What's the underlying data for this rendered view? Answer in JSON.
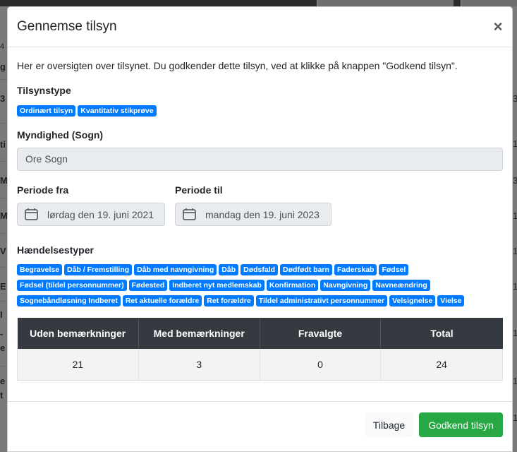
{
  "modal": {
    "title": "Gennemse tilsyn",
    "intro": "Her er oversigten over tilsynet. Du godkender dette tilsyn, ved at klikke på knappen \"Godkend tilsyn\".",
    "tilsynstype": {
      "label": "Tilsynstype",
      "badges": [
        "Ordinært tilsyn",
        "Kvantitativ stikprøve"
      ]
    },
    "myndighed": {
      "label": "Myndighed (Sogn)",
      "value": "Ore Sogn"
    },
    "periode_fra": {
      "label": "Periode fra",
      "value": "lørdag den 19. juni 2021"
    },
    "periode_til": {
      "label": "Periode til",
      "value": "mandag den 19. juni 2023"
    },
    "haendelsestyper": {
      "label": "Hændelsestyper",
      "badges": [
        "Begravelse",
        "Dåb / Fremstilling",
        "Dåb med navngivning",
        "Dåb",
        "Dødsfald",
        "Dødfødt barn",
        "Faderskab",
        "Fødsel",
        "Fødsel (tildel personnummer)",
        "Fødested",
        "Indberet nyt medlemskab",
        "Konfirmation",
        "Navngivning",
        "Navneændring",
        "Sognebåndløsning Indberet",
        "Ret aktuelle forældre",
        "Ret forældre",
        "Tildel administrativt personnummer",
        "Velsignelse",
        "Vielse"
      ]
    },
    "stats_table": {
      "headers": [
        "Uden bemærkninger",
        "Med bemærkninger",
        "Fravalgte",
        "Total"
      ],
      "values": [
        "21",
        "3",
        "0",
        "24"
      ]
    },
    "buttons": {
      "back": "Tilbage",
      "approve": "Godkend tilsyn"
    }
  },
  "background": {
    "left_fragments": [
      "4",
      "g",
      "3",
      "ti",
      "M",
      "M",
      "V",
      "E",
      "I",
      "-",
      "e",
      "e",
      "t"
    ],
    "right_fragments": [
      "3",
      "1",
      "3",
      "1",
      "1",
      "1",
      "1",
      "1",
      "1"
    ]
  },
  "icons": {
    "close": "close-icon",
    "calendar": "calendar-icon"
  },
  "colors": {
    "badge": "#007bff",
    "table_header": "#343a40",
    "approve": "#28a745",
    "readonly_bg": "#e9ecef"
  }
}
